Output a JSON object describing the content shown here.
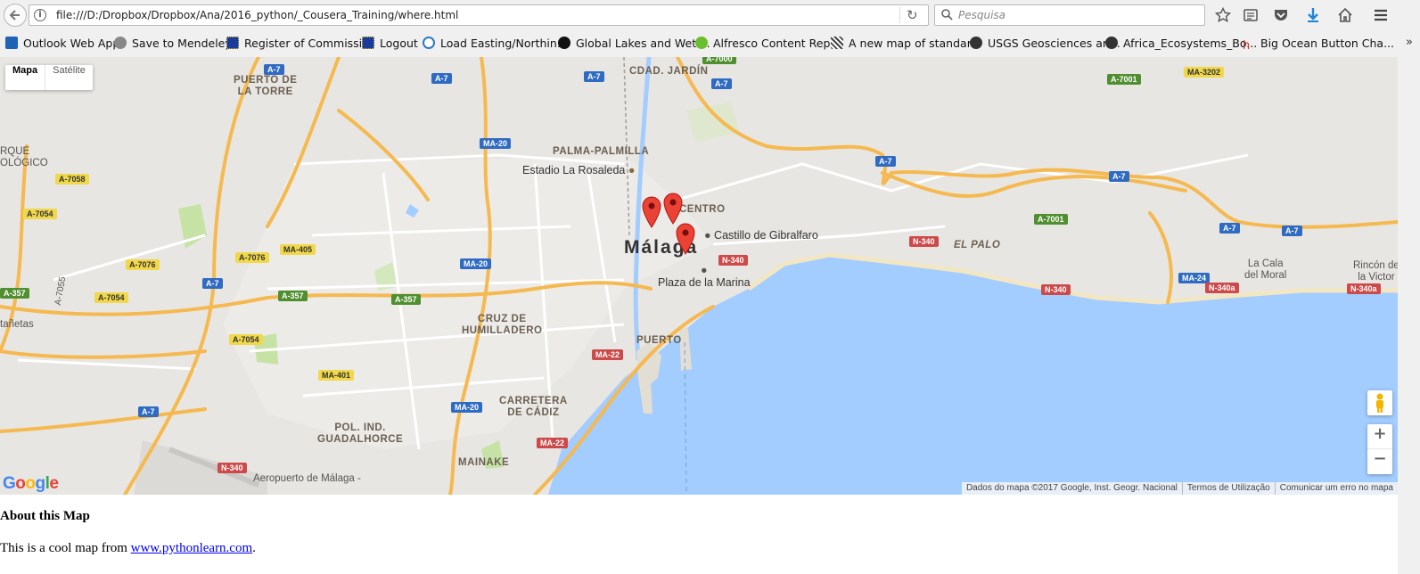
{
  "browser": {
    "url": "file:///D:/Dropbox/Dropbox/Ana/2016_python/_Cousera_Training/where.html",
    "search_placeholder": "Pesquisa",
    "bookmarks": [
      {
        "label": "Outlook Web App",
        "icon": "outlook-icon",
        "color": "#1e63b6"
      },
      {
        "label": "Save to Mendeley",
        "icon": "globe-icon",
        "color": "#777777"
      },
      {
        "label": "Register of Commissi...",
        "icon": "eu-flag-icon",
        "color": "#1a3a9c"
      },
      {
        "label": "Logout",
        "icon": "eu-flag-icon",
        "color": "#1a3a9c"
      },
      {
        "label": "Load Easting/Northin...",
        "icon": "wordpress-icon",
        "color": "#2a7ac0"
      },
      {
        "label": "Global Lakes and Wetl...",
        "icon": "wwf-panda-icon",
        "color": "#111111"
      },
      {
        "label": "Alfresco Content Rep...",
        "icon": "alfresco-icon",
        "color": "#6abf2e"
      },
      {
        "label": "A new map of standar...",
        "icon": "map-lines-icon",
        "color": "#444444"
      },
      {
        "label": "USGS Geosciences an...",
        "icon": "usgs-icon",
        "color": "#333333"
      },
      {
        "label": "Africa_Ecosystems_Bo...",
        "icon": "usgs-icon",
        "color": "#333333"
      },
      {
        "label": "Big Ocean Button Cha...",
        "icon": "hx-icon",
        "color": "#c0392b"
      }
    ]
  },
  "map": {
    "type_controls": {
      "map": "Mapa",
      "satellite": "Satélite"
    },
    "city": "Málaga",
    "districts": [
      "CDAD. JARDÍN",
      "PUERTO DE LA TORRE",
      "PALMA-PALMILLA",
      "CENTRO",
      "CRUZ DE HUMILLADERO",
      "PUERTO",
      "CARRETERA DE CÁDIZ",
      "POL. IND. GUADALHORCE",
      "MAINAKE",
      "EL PALO"
    ],
    "district_lines": {
      "puerto_torre": [
        "PUERTO DE",
        "LA TORRE"
      ],
      "cruz": [
        "CRUZ DE",
        "HUMILLADERO"
      ],
      "carretera": [
        "CARRETERA",
        "DE CÁDIZ"
      ],
      "guadalhorce": [
        "POL. IND.",
        "GUADALHORCE"
      ]
    },
    "pois": [
      "Estadio La Rosaleda",
      "Castillo de Gibralfaro",
      "Plaza de la Marina"
    ],
    "places": {
      "la_cala": [
        "La Cala",
        "del Moral"
      ],
      "rincon": [
        "Rincón de",
        "la Victor"
      ],
      "aeropuerto": "Aeropuerto de Málaga -",
      "rque": [
        "RQUE",
        "OLÓGICO"
      ],
      "tanetas": "tañetas",
      "a7055": "A-7055"
    },
    "road_shields": {
      "a7_1": "A-7",
      "a7_2": "A-7",
      "a7_3": "A-7",
      "a7_4": "A-7",
      "a7_5": "A-7",
      "a7_6": "A-7",
      "a7_7": "A-7",
      "a7_8": "A-7",
      "a7_9": "A-7",
      "a7_10": "A-7",
      "ma20_1": "MA-20",
      "ma20_2": "MA-20",
      "ma20_3": "MA-20",
      "a7058": "A-7058",
      "a7054_1": "A-7054",
      "a7054_2": "A-7054",
      "a7054_3": "A-7054",
      "ma405": "MA-405",
      "a7076_1": "A-7076",
      "a7076_2": "A-7076",
      "a357_1": "A-357",
      "a357_2": "A-357",
      "a357_3": "A-357",
      "ma401": "MA-401",
      "ma22_1": "MA-22",
      "ma22_2": "MA-22",
      "n340_1": "N-340",
      "n340_2": "N-340",
      "n340_3": "N-340",
      "n340_4": "N-340",
      "n340a_1": "N-340a",
      "n340a_2": "N-340a",
      "a7001_1": "A-7001",
      "a7001_2": "A-7001",
      "ma3202": "MA-3202",
      "ma24": "MA-24",
      "a7000": "A-7000"
    },
    "markers": 3,
    "google_logo": "Google",
    "attribution": {
      "data": "Dados do mapa ©2017 Google, Inst. Geogr. Nacional",
      "terms": "Termos de Utilização",
      "report": "Comunicar um erro no mapa"
    },
    "colors": {
      "water": "#a3ccff",
      "land": "#e8e6e2",
      "motorway": "#f5b94f",
      "marker": "#e74c3c"
    }
  },
  "page": {
    "title": "About this Map",
    "text_before": "This is a cool map from ",
    "link": "www.pythonlearn.com",
    "text_after": "."
  }
}
